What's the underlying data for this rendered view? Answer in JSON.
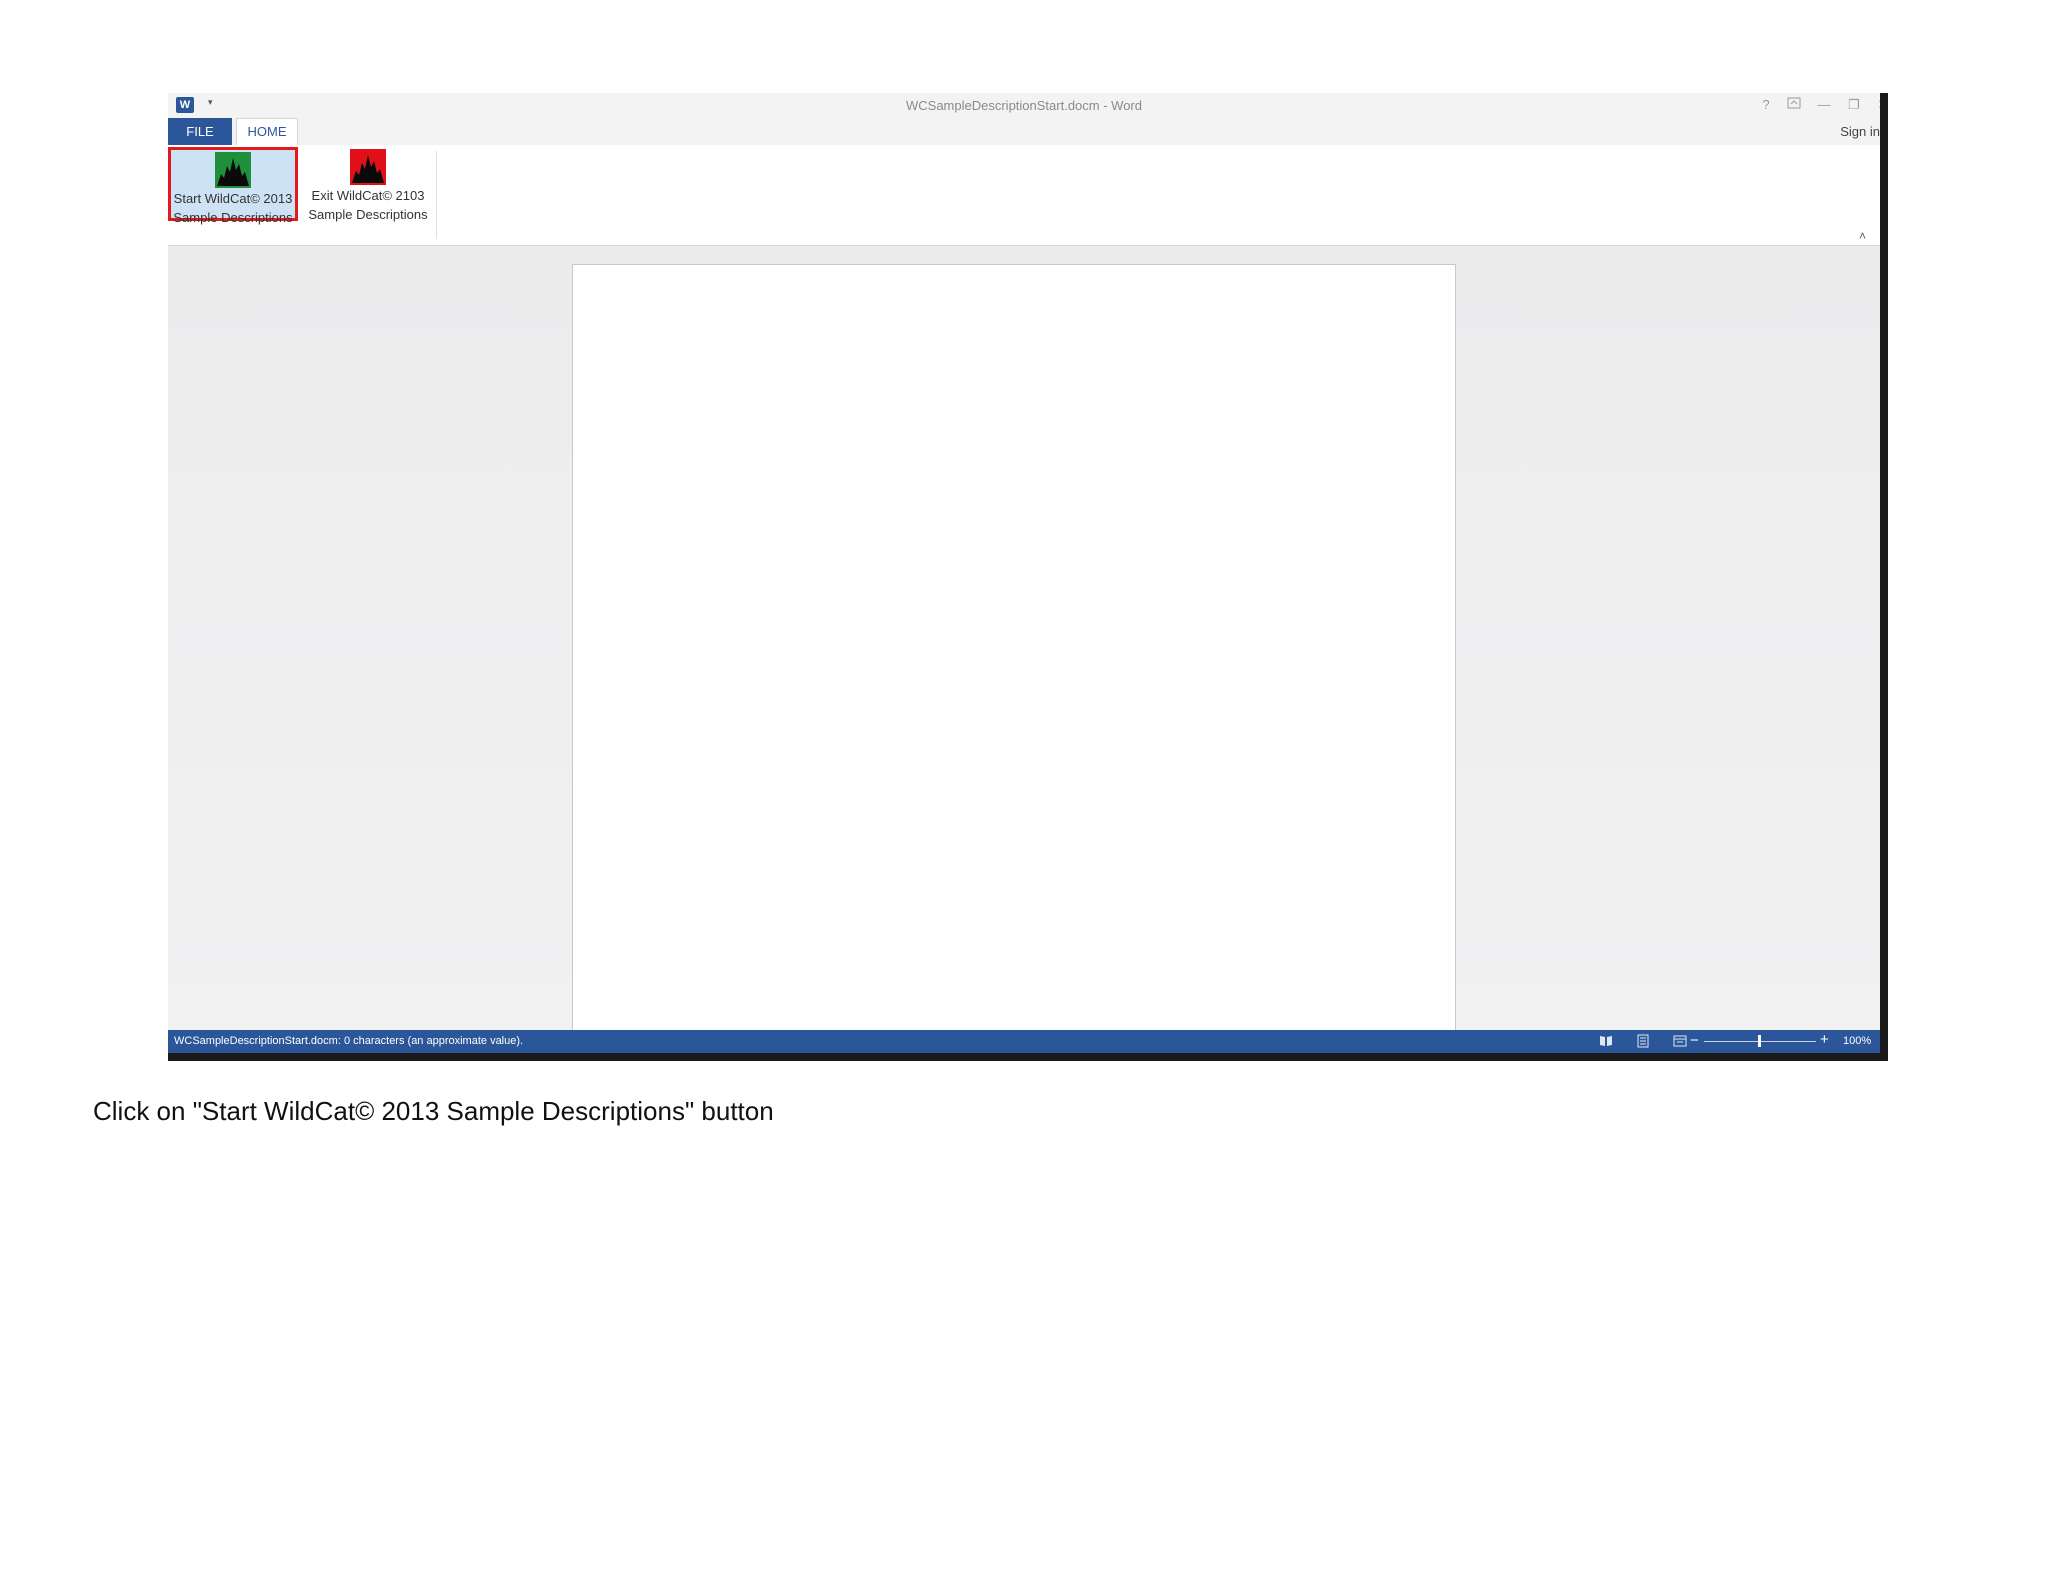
{
  "window": {
    "title": "WCSampleDescriptionStart.docm - Word",
    "app_icon_letter": "W",
    "qat_arrow": "▾",
    "controls": {
      "help": "?",
      "ribbon_display": "⬚",
      "minimize": "—",
      "restore": "❐",
      "close": "✕"
    },
    "sign_in": "Sign in"
  },
  "tabs": [
    {
      "label": "FILE"
    },
    {
      "label": "HOME"
    }
  ],
  "ribbon": {
    "start_button": {
      "line1": "Start WildCat© 2013",
      "line2": "Sample Descriptions",
      "icon": "wildcat-green-icon",
      "color": "#1f8f3a"
    },
    "exit_button": {
      "line1": "Exit WildCat© 2103",
      "line2": "Sample Descriptions",
      "icon": "wildcat-red-icon",
      "color": "#e0101a"
    },
    "collapse": "˄"
  },
  "statusbar": {
    "text": "WCSampleDescriptionStart.docm: 0 characters (an approximate value).",
    "zoom_minus": "−",
    "zoom_plus": "+",
    "zoom_level": "100%",
    "zoom_value": 100
  },
  "colors": {
    "accent": "#2b579a",
    "highlight": "#e21a1a"
  },
  "caption": "Click on \"Start WildCat© 2013 Sample Descriptions\" button"
}
